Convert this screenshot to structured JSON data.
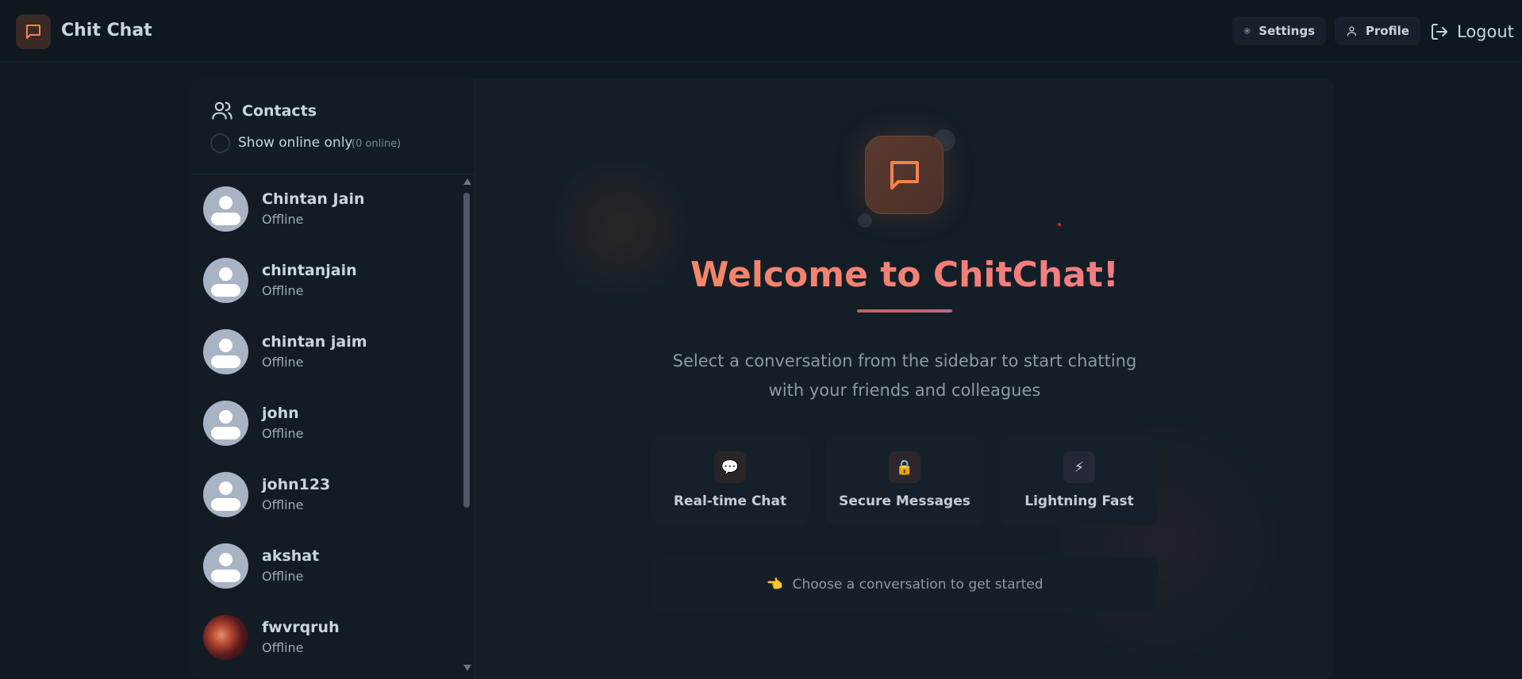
{
  "app": {
    "title": "Chit Chat",
    "brand_icon": "chat-bubble-icon",
    "accent_color": "#f0834f"
  },
  "header": {
    "settings_label": "Settings",
    "profile_label": "Profile",
    "logout_label": "Logout"
  },
  "sidebar": {
    "title": "Contacts",
    "online_filter_label": "Show online only",
    "online_count": "(0 online)",
    "contacts": [
      {
        "name": "Chintan Jain",
        "status": "Offline",
        "avatar": "default"
      },
      {
        "name": "chintanjain",
        "status": "Offline",
        "avatar": "default"
      },
      {
        "name": "chintan jaim",
        "status": "Offline",
        "avatar": "default"
      },
      {
        "name": "john",
        "status": "Offline",
        "avatar": "default"
      },
      {
        "name": "john123",
        "status": "Offline",
        "avatar": "default"
      },
      {
        "name": "akshat",
        "status": "Offline",
        "avatar": "default"
      },
      {
        "name": "fwvrqruh",
        "status": "Offline",
        "avatar": "photo"
      }
    ]
  },
  "welcome": {
    "title": "Welcome to ChitChat!",
    "subtitle": "Select a conversation from the sidebar to start chatting with your friends and colleagues",
    "features": [
      {
        "icon": "💬",
        "icon_name": "speech-bubble-icon",
        "label": "Real-time Chat"
      },
      {
        "icon": "🔒",
        "icon_name": "lock-icon",
        "label": "Secure Messages"
      },
      {
        "icon": "⚡",
        "icon_name": "lightning-icon",
        "label": "Lightning Fast"
      }
    ],
    "prompt_icon": "👈",
    "prompt": "Choose a conversation to get started"
  }
}
